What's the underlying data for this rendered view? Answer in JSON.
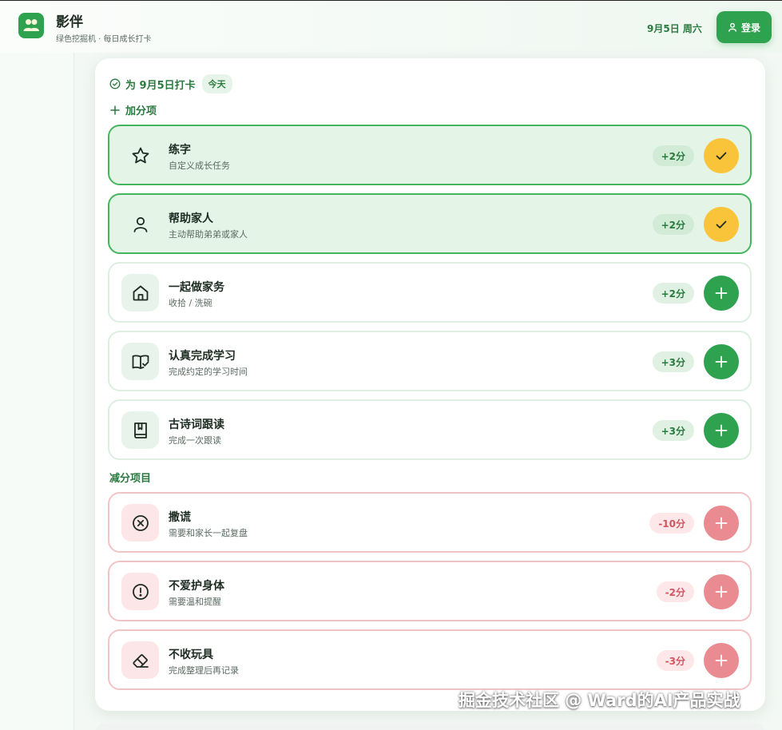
{
  "app": {
    "title": "影伴",
    "subtitle": "绿色挖掘机 · 每日成长打卡",
    "date": "9月5日 周六",
    "login_label": "登录"
  },
  "checkin": {
    "title": "为 9月5日打卡",
    "today_badge": "今天",
    "add_label": "加分项"
  },
  "positive_items": [
    {
      "name": "练字",
      "desc": "自定义成长任务",
      "score": "+2分",
      "done": true,
      "icon": "star-icon"
    },
    {
      "name": "帮助家人",
      "desc": "主动帮助弟弟或家人",
      "score": "+2分",
      "done": true,
      "icon": "person-icon"
    },
    {
      "name": "一起做家务",
      "desc": "收拾 / 洗碗",
      "score": "+2分",
      "done": false,
      "icon": "home-icon"
    },
    {
      "name": "认真完成学习",
      "desc": "完成约定的学习时间",
      "score": "+3分",
      "done": false,
      "icon": "book-check-icon"
    },
    {
      "name": "古诗词跟读",
      "desc": "完成一次跟读",
      "score": "+3分",
      "done": false,
      "icon": "bookmark-book-icon"
    }
  ],
  "negative_section_title": "减分项目",
  "negative_items": [
    {
      "name": "撒谎",
      "desc": "需要和家长一起复盘",
      "score": "-10分",
      "icon": "x-circle-icon"
    },
    {
      "name": "不爱护身体",
      "desc": "需要温和提醒",
      "score": "-2分",
      "icon": "alert-circle-icon"
    },
    {
      "name": "不收玩具",
      "desc": "完成整理后再记录",
      "score": "-3分",
      "icon": "eraser-icon"
    }
  ],
  "watermark": "掘金技术社区 @ Ward的AI产品实战",
  "colors": {
    "brand_green": "#2fa24f",
    "done_yellow": "#fac43a",
    "negative_red": "#e98b91"
  }
}
